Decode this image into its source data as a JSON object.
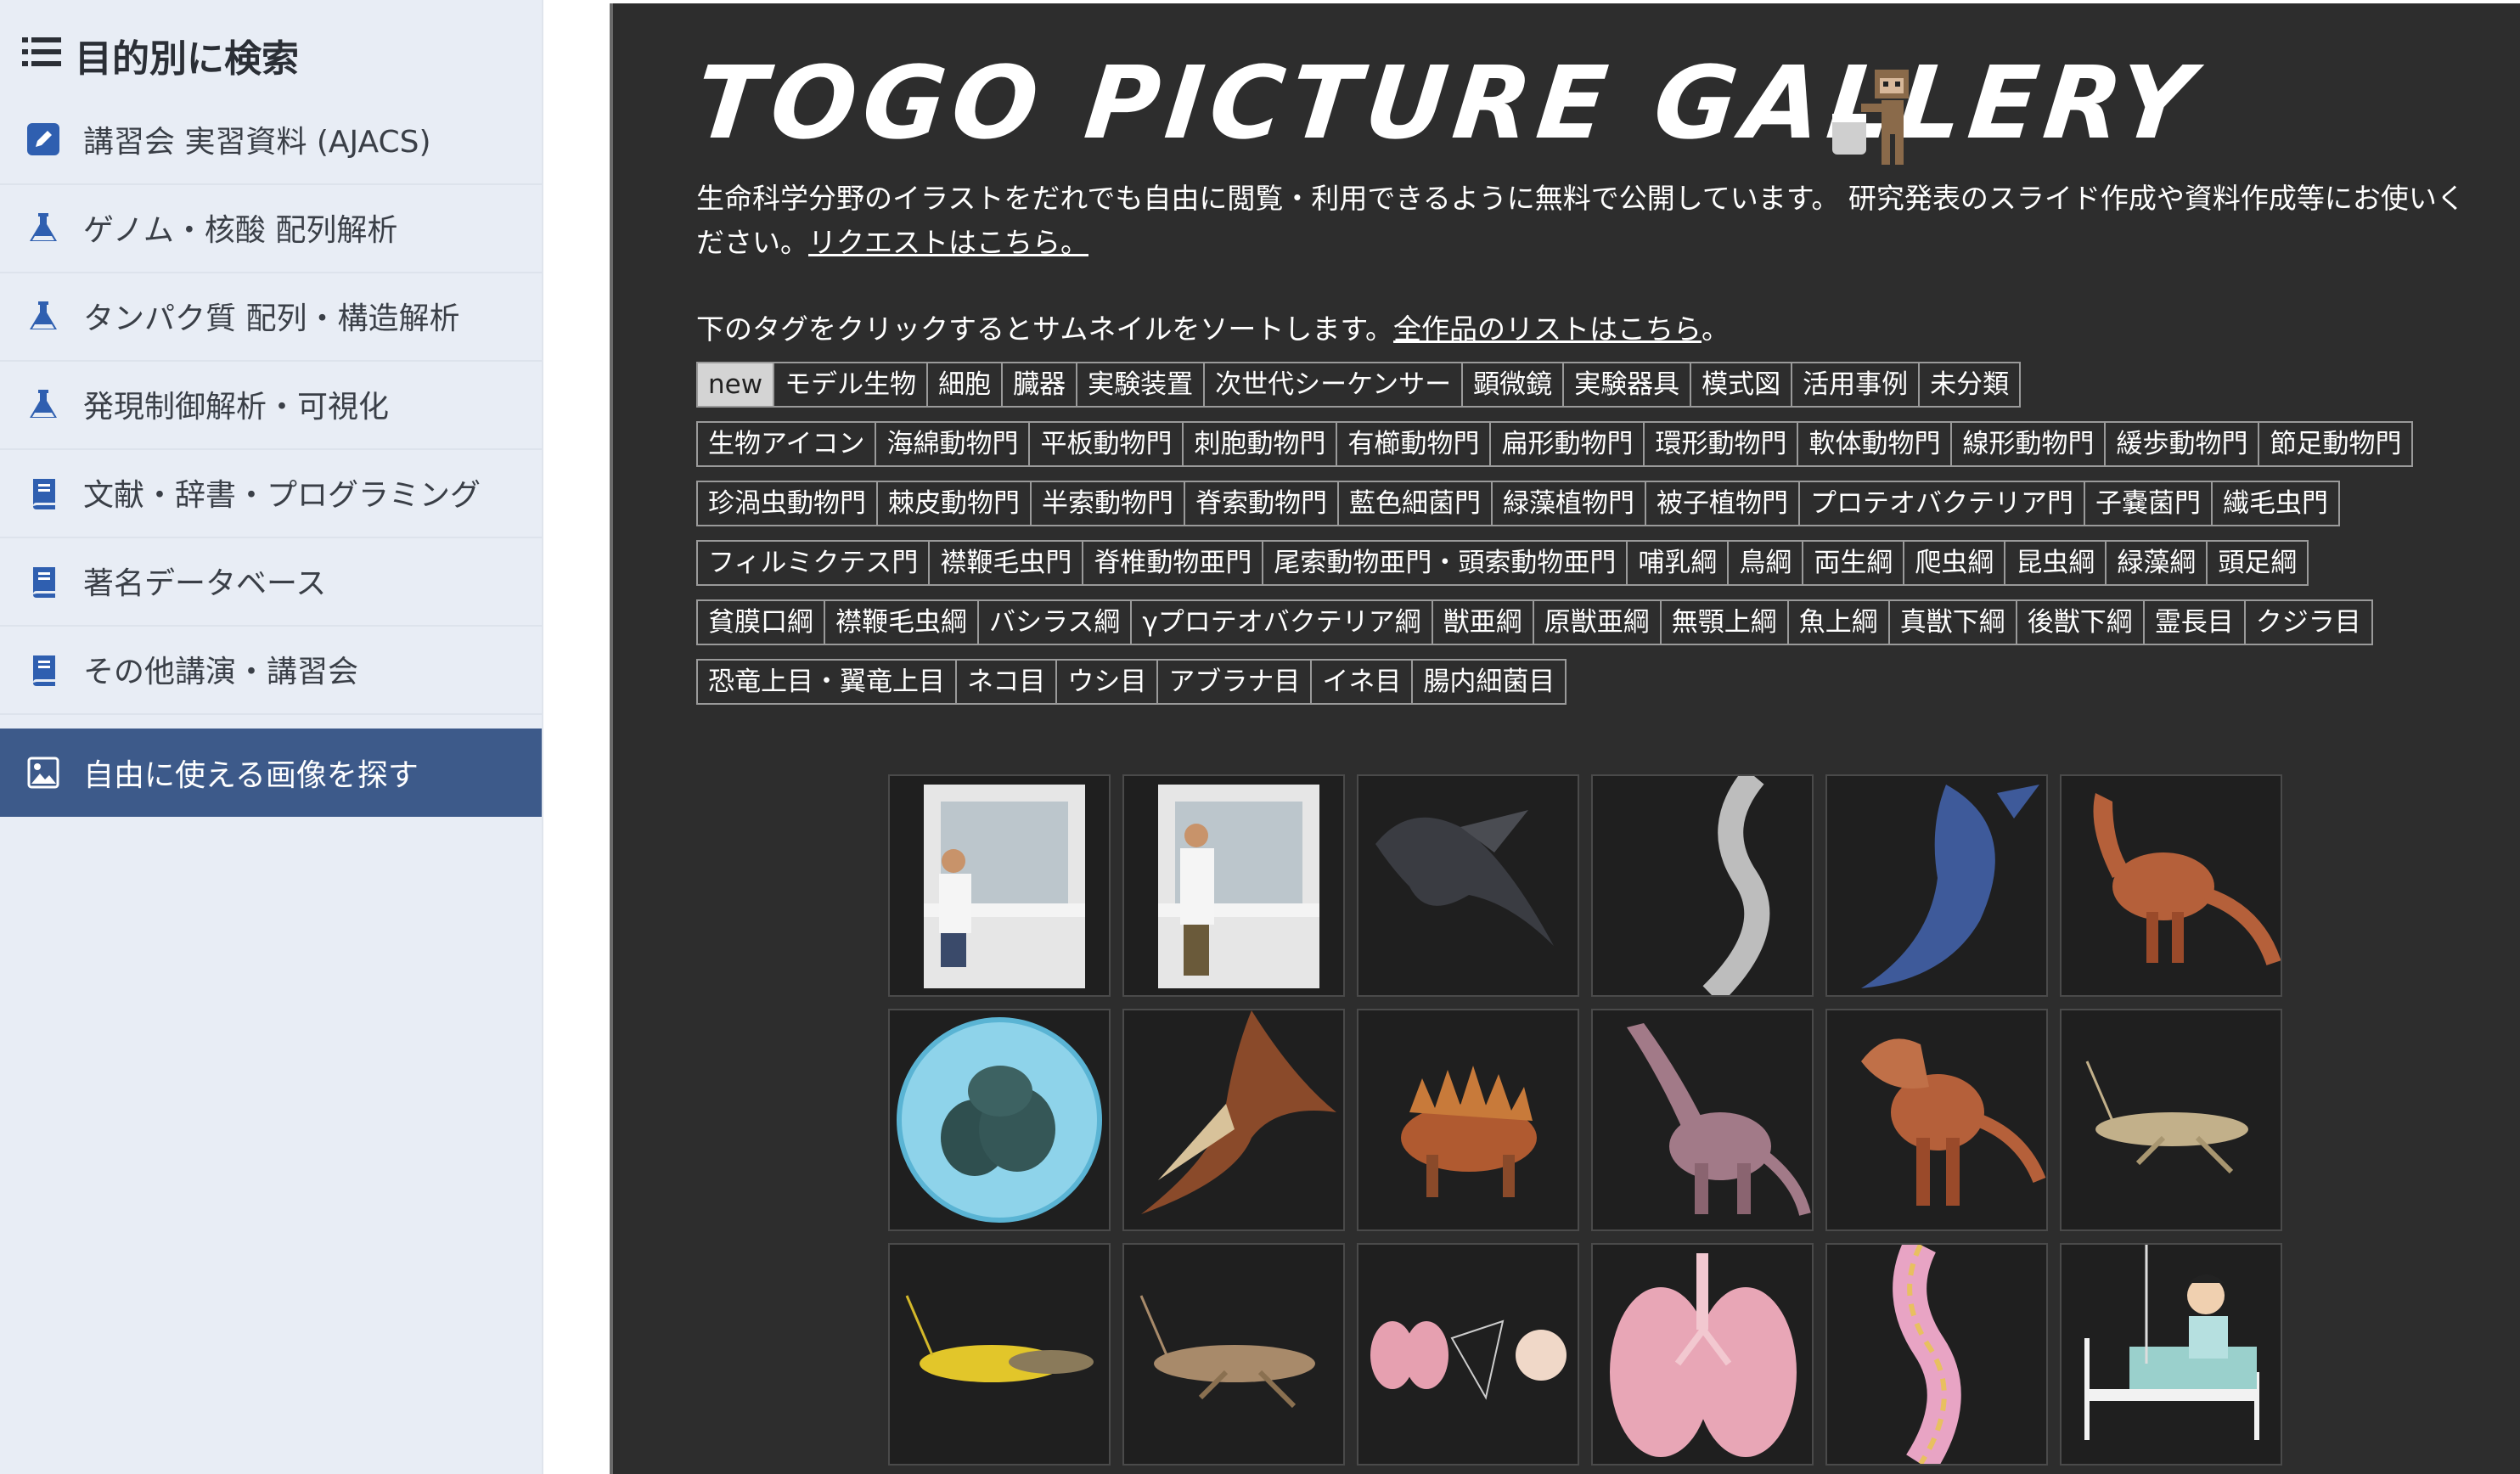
{
  "sidebar": {
    "header": "目的別に検索",
    "items": [
      {
        "label": "講習会 実習資料 (AJACS)",
        "icon": "pencil-square-icon"
      },
      {
        "label": "ゲノム・核酸 配列解析",
        "icon": "flask-icon"
      },
      {
        "label": "タンパク質 配列・構造解析",
        "icon": "flask-icon"
      },
      {
        "label": "発現制御解析・可視化",
        "icon": "flask-icon"
      },
      {
        "label": "文献・辞書・プログラミング",
        "icon": "book-icon"
      },
      {
        "label": "著名データベース",
        "icon": "book-icon"
      },
      {
        "label": "その他講演・講習会",
        "icon": "book-icon"
      },
      {
        "label": "自由に使える画像を探す",
        "icon": "image-icon",
        "active": true
      }
    ],
    "colors": {
      "background": "#e8edf5",
      "active": "#3d5a8a",
      "icon": "#2f5fb0"
    }
  },
  "main": {
    "logo": "TOGO PICTURE GALLERY",
    "description": "生命科学分野のイラストをだれでも自由に閲覧・利用できるように無料で公開しています。 研究発表のスライド作成や資料作成等にお使いください。",
    "request_link": "リクエストはこちら。",
    "sort_text": "下のタグをクリックするとサムネイルをソートします。",
    "all_works_link": "全作品のリストはこちら",
    "sort_suffix": "。",
    "tag_rows": [
      [
        "new",
        "モデル生物",
        "細胞",
        "臓器",
        "実験装置",
        "次世代シーケンサー",
        "顕微鏡",
        "実験器具",
        "模式図",
        "活用事例",
        "未分類"
      ],
      [
        "生物アイコン",
        "海綿動物門",
        "平板動物門",
        "刺胞動物門",
        "有櫛動物門",
        "扁形動物門",
        "環形動物門",
        "軟体動物門",
        "線形動物門",
        "緩歩動物門",
        "節足動物門"
      ],
      [
        "珍渦虫動物門",
        "棘皮動物門",
        "半索動物門",
        "脊索動物門",
        "藍色細菌門",
        "緑藻植物門",
        "被子植物門",
        "プロテオバクテリア門",
        "子嚢菌門",
        "繊毛虫門"
      ],
      [
        "フィルミクテス門",
        "襟鞭毛虫門",
        "脊椎動物亜門",
        "尾索動物亜門・頭索動物亜門",
        "哺乳綱",
        "鳥綱",
        "両生綱",
        "爬虫綱",
        "昆虫綱",
        "緑藻綱",
        "頭足綱"
      ],
      [
        "貧膜口綱",
        "襟鞭毛虫綱",
        "バシラス綱",
        "γプロテオバクテリア綱",
        "獣亜綱",
        "原獣亜綱",
        "無顎上綱",
        "魚上綱",
        "真獣下綱",
        "後獣下綱",
        "霊長目",
        "クジラ目"
      ],
      [
        "恐竜上目・翼竜上目",
        "ネコ目",
        "ウシ目",
        "アブラナ目",
        "イネ目",
        "腸内細菌目"
      ]
    ],
    "selected_tag": "new",
    "thumbnails": [
      "clean-bench-worker-seated",
      "clean-bench-worker-standing",
      "feathered-dinosaur",
      "nematode-worm",
      "ichthyosaur",
      "theropod-dinosaur",
      "cell-colony-sphere",
      "pterosaur",
      "stegosaurus",
      "sauropod",
      "tyrannosaurus",
      "locust",
      "locust-yellow",
      "locust-brown",
      "lungs-alveoli-diagram",
      "lungs",
      "intestine-villi",
      "hospital-patient"
    ],
    "colors": {
      "background": "#2d2d2d",
      "selected_tag": "#d4d4d4"
    }
  }
}
